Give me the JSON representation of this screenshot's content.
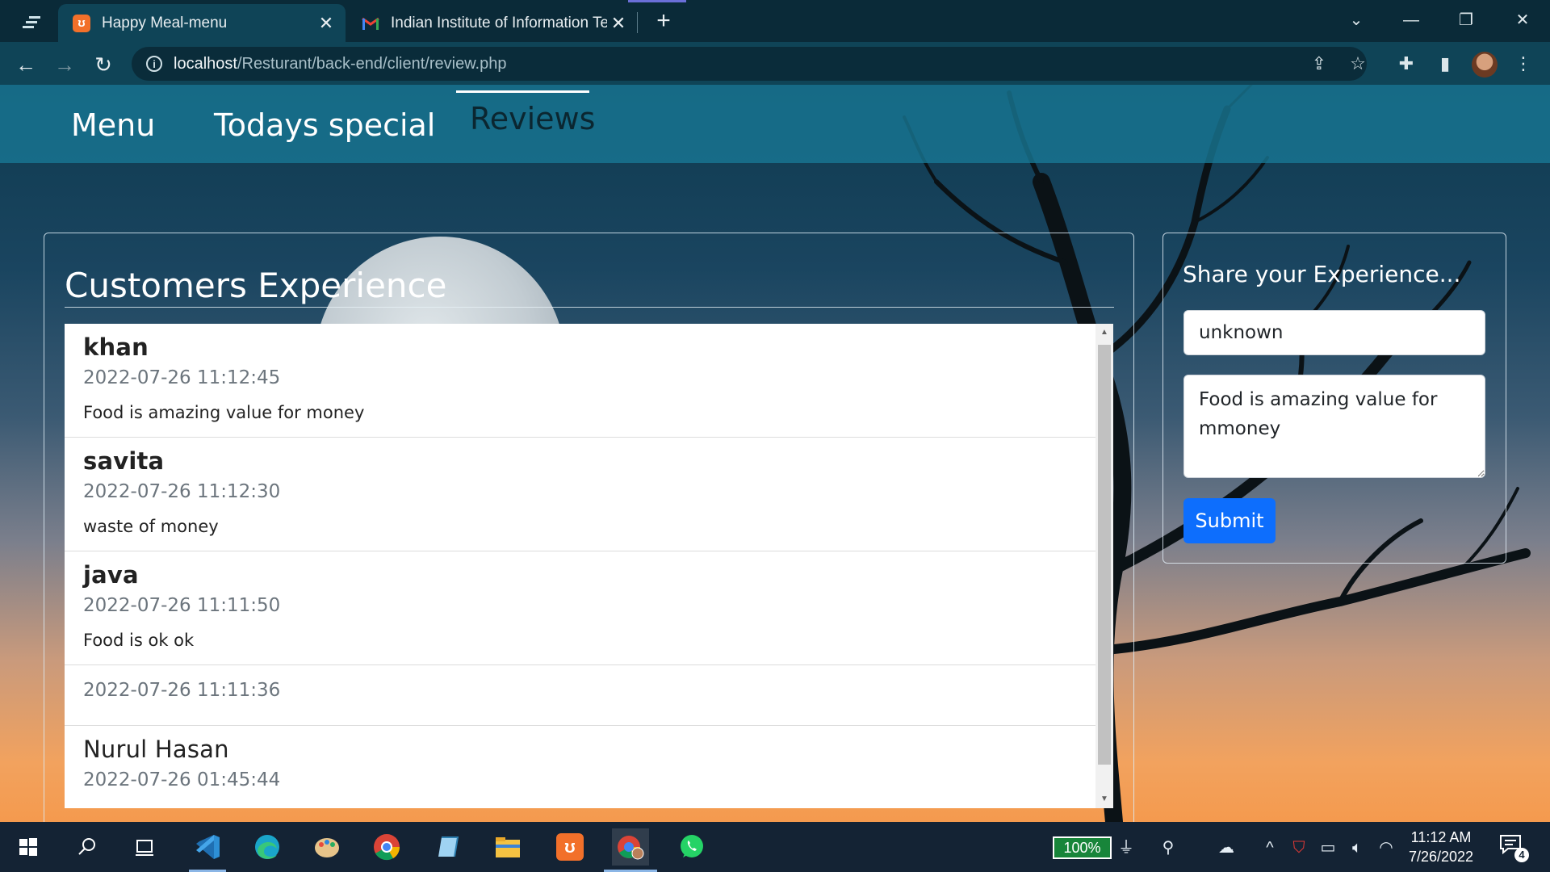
{
  "browser": {
    "tabs": [
      {
        "title": "Happy Meal-menu",
        "favicon": "xampp-icon",
        "active": true
      },
      {
        "title": "Indian Institute of Information Te",
        "favicon": "gmail-icon",
        "active": false
      }
    ],
    "url": {
      "host": "localhost",
      "path": "/Resturant/back-end/client/review.php"
    }
  },
  "navbar": {
    "links": [
      {
        "label": "Menu"
      },
      {
        "label": "Todays special"
      },
      {
        "label": "Reviews",
        "active": true
      }
    ]
  },
  "reviews_section": {
    "title": "Customers Experience",
    "items": [
      {
        "name": "khan",
        "date": "2022-07-26 11:12:45",
        "message": "Food is amazing value for money"
      },
      {
        "name": "savita",
        "date": "2022-07-26 11:12:30",
        "message": "waste of money"
      },
      {
        "name": "java",
        "date": "2022-07-26 11:11:50",
        "message": "Food is ok ok"
      },
      {
        "name": "",
        "date": "2022-07-26 11:11:36",
        "message": ""
      },
      {
        "name": "Nurul Hasan",
        "date": "2022-07-26 01:45:44",
        "message": ""
      }
    ]
  },
  "share_form": {
    "title": "Share your Experience...",
    "name_value": "unknown",
    "review_value": "Food is amazing value for mmoney",
    "submit_label": "Submit"
  },
  "taskbar": {
    "battery_percent": "100%",
    "time": "11:12 AM",
    "date": "7/26/2022",
    "notification_count": "4"
  },
  "colors": {
    "navbar": "#1878a0",
    "submit": "#0d6efd",
    "browser_dark": "#0a2a38",
    "taskbar": "#142334"
  }
}
